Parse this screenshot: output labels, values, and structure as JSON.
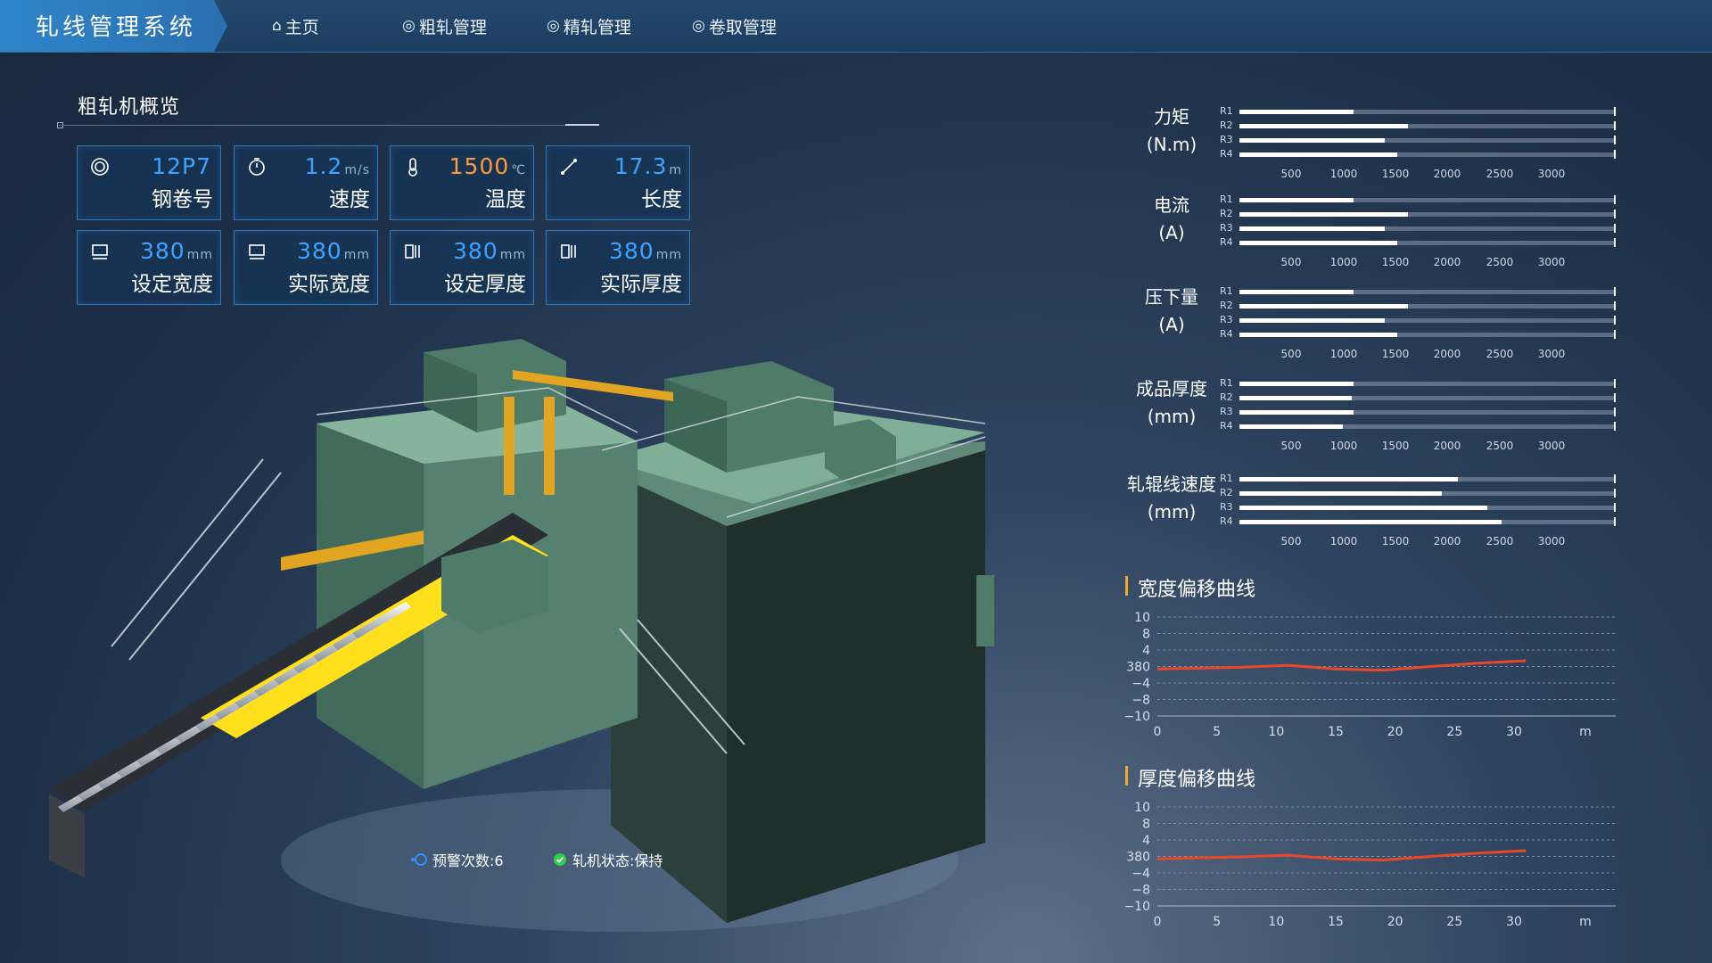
{
  "header": {
    "title": "轧线管理系统",
    "nav": [
      {
        "icon": "home-icon",
        "glyph": "⌂",
        "label": "主页"
      },
      {
        "icon": "rough-rolling-icon",
        "glyph": "◎",
        "label": "粗轧管理"
      },
      {
        "icon": "finish-rolling-icon",
        "glyph": "◎",
        "label": "精轧管理"
      },
      {
        "icon": "coiling-icon",
        "glyph": "◎",
        "label": "卷取管理"
      }
    ]
  },
  "overview": {
    "title": "粗轧机概览",
    "cards": [
      {
        "icon": "coil-icon",
        "value": "12P7",
        "unit": "",
        "label": "钢卷号",
        "accent": "#3ea2ff"
      },
      {
        "icon": "stopwatch-icon",
        "value": "1.2",
        "unit": "m/s",
        "label": "速度",
        "accent": "#3ea2ff"
      },
      {
        "icon": "thermometer-icon",
        "value": "1500",
        "unit": "℃",
        "label": "温度",
        "accent": "#ff9a3c"
      },
      {
        "icon": "ruler-icon",
        "value": "17.3",
        "unit": "m",
        "label": "长度",
        "accent": "#3ea2ff"
      },
      {
        "icon": "width-icon",
        "value": "380",
        "unit": "mm",
        "label": "设定宽度",
        "accent": "#3ea2ff"
      },
      {
        "icon": "width-icon",
        "value": "380",
        "unit": "mm",
        "label": "实际宽度",
        "accent": "#3ea2ff"
      },
      {
        "icon": "thickness-icon",
        "value": "380",
        "unit": "mm",
        "label": "设定厚度",
        "accent": "#3ea2ff"
      },
      {
        "icon": "thickness-icon",
        "value": "380",
        "unit": "mm",
        "label": "实际厚度",
        "accent": "#3ea2ff"
      }
    ]
  },
  "status": {
    "warning": "预警次数:6",
    "mill_state": "轧机状态:保持",
    "warning_color": "#2f8fff",
    "mill_state_color": "#2fcf4a"
  },
  "chart_data": [
    {
      "type": "bar",
      "title_lines": [
        "力矩",
        "(N.m)"
      ],
      "categories": [
        "R1",
        "R2",
        "R3",
        "R4"
      ],
      "values": [
        1100,
        1620,
        1400,
        1520
      ],
      "ticks": [
        "500",
        "1000",
        "1500",
        "2000",
        "2500",
        "3000"
      ],
      "xlim": [
        0,
        3600
      ]
    },
    {
      "type": "bar",
      "title_lines": [
        "电流",
        "(A)"
      ],
      "categories": [
        "R1",
        "R2",
        "R3",
        "R4"
      ],
      "values": [
        1100,
        1620,
        1400,
        1520
      ],
      "ticks": [
        "500",
        "1000",
        "1500",
        "2000",
        "2500",
        "3000"
      ],
      "xlim": [
        0,
        3600
      ]
    },
    {
      "type": "bar",
      "title_lines": [
        "压下量",
        "(A)"
      ],
      "categories": [
        "R1",
        "R2",
        "R3",
        "R4"
      ],
      "values": [
        1100,
        1620,
        1400,
        1520
      ],
      "ticks": [
        "500",
        "1000",
        "1500",
        "2000",
        "2500",
        "3000"
      ],
      "xlim": [
        0,
        3600
      ]
    },
    {
      "type": "bar",
      "title_lines": [
        "成品厚度",
        "(mm)"
      ],
      "categories": [
        "R1",
        "R2",
        "R3",
        "R4"
      ],
      "values": [
        1100,
        1080,
        1100,
        990
      ],
      "ticks": [
        "500",
        "1000",
        "1500",
        "2000",
        "2500",
        "3000"
      ],
      "xlim": [
        0,
        3600
      ]
    },
    {
      "type": "bar",
      "title_lines": [
        "轧辊线速度",
        "(mm)"
      ],
      "categories": [
        "R1",
        "R2",
        "R3",
        "R4"
      ],
      "values": [
        2100,
        1950,
        2380,
        2520
      ],
      "ticks": [
        "500",
        "1000",
        "1500",
        "2000",
        "2500",
        "3000"
      ],
      "xlim": [
        0,
        3600
      ]
    },
    {
      "type": "line",
      "title": "宽度偏移曲线",
      "yticks": [
        "10",
        "8",
        "4",
        "380",
        "−4",
        "−8",
        "−10"
      ],
      "xticks": [
        "0",
        "5",
        "10",
        "15",
        "20",
        "25",
        "30"
      ],
      "xunit": "m",
      "x": [
        0,
        7,
        11,
        15,
        19,
        23,
        27,
        31
      ],
      "y": [
        -0.6,
        -0.2,
        0.3,
        -0.6,
        -0.9,
        0.0,
        0.8,
        1.4
      ],
      "line_color": "#e8472a"
    },
    {
      "type": "line",
      "title": "厚度偏移曲线",
      "yticks": [
        "10",
        "8",
        "4",
        "380",
        "−4",
        "−8",
        "−10"
      ],
      "xticks": [
        "0",
        "5",
        "10",
        "15",
        "20",
        "25",
        "30"
      ],
      "xunit": "m",
      "x": [
        0,
        7,
        11,
        15,
        19,
        23,
        27,
        31
      ],
      "y": [
        -0.6,
        -0.1,
        0.3,
        -0.6,
        -0.9,
        0.0,
        0.8,
        1.4
      ],
      "line_color": "#e8472a"
    }
  ]
}
